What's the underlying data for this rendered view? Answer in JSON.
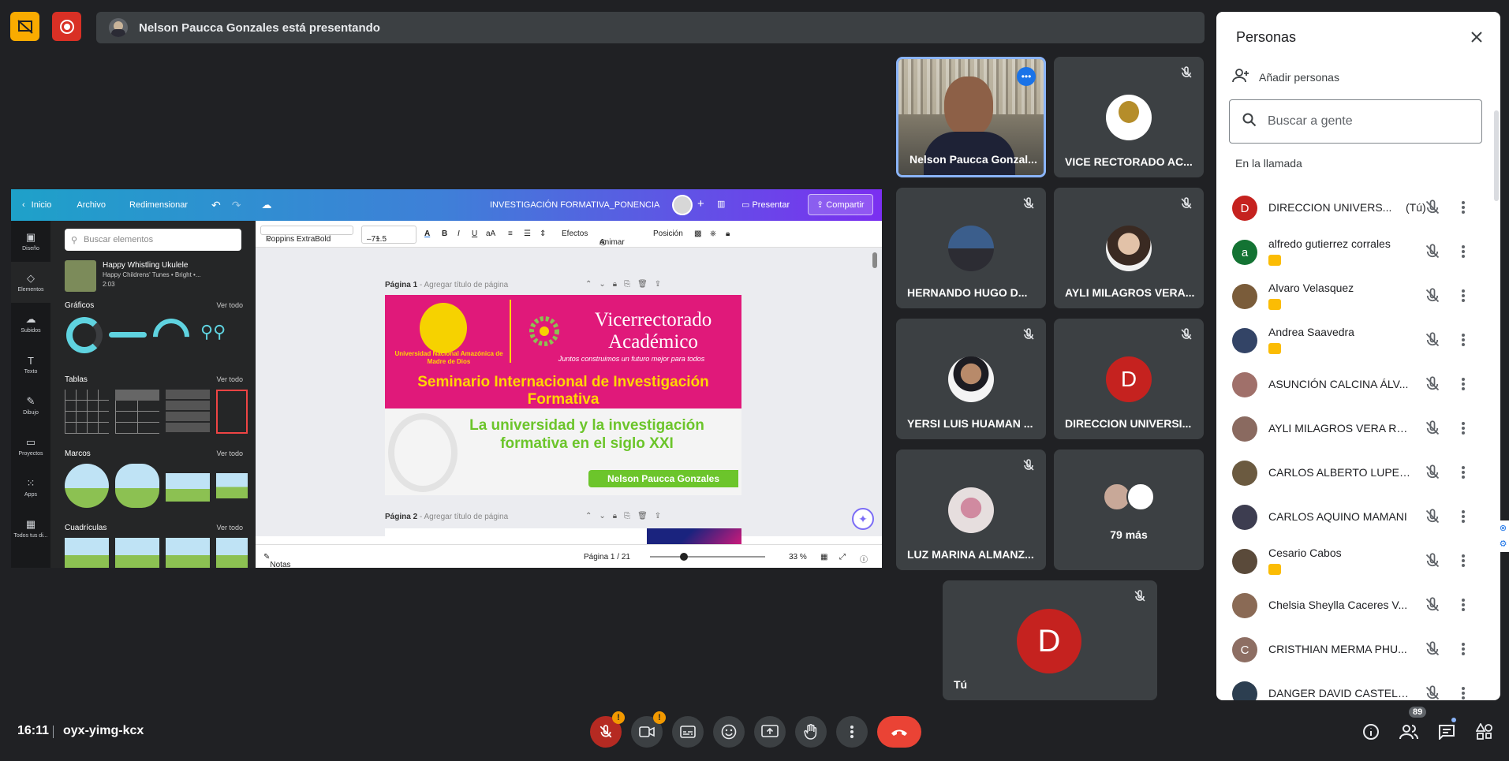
{
  "presenting_banner": "Nelson Paucca Gonzales está presentando",
  "canva": {
    "nav": {
      "home": "Inicio",
      "file": "Archivo",
      "resize": "Redimensionar"
    },
    "doc_title": "INVESTIGACIÓN FORMATIVA_PONENCIA",
    "present": "Presentar",
    "share": "Compartir",
    "rail": [
      "Diseño",
      "Elementos",
      "Subidos",
      "Texto",
      "Dibujo",
      "Proyectos",
      "Apps",
      "Todos tus di..."
    ],
    "search_placeholder": "Buscar elementos",
    "audio": {
      "title": "Happy Whistling Ukulele",
      "sub": "Happy Childrens' Tunes • Bright •...",
      "duration": "2:03"
    },
    "sections": {
      "graphics": "Gráficos",
      "tables": "Tablas",
      "frames": "Marcos",
      "grids": "Cuadrículas",
      "see_all": "Ver todo"
    },
    "toolbar": {
      "font": "Poppins ExtraBold",
      "size": "71.5",
      "minus": "–",
      "plus": "+",
      "effects": "Efectos",
      "animate": "Animar",
      "position": "Posición"
    },
    "page1": {
      "label": "Página 1",
      "hint": "- Agregar título de página"
    },
    "page2": {
      "label": "Página 2",
      "hint": "- Agregar título de página"
    },
    "slide": {
      "vice": "Vicerrectorado Académico",
      "university": "Universidad Nacional Amazónica de Madre de Dios",
      "motto": "Juntos construimos un futuro mejor para todos",
      "seminar": "Seminario Internacional de Investigación Formativa",
      "subtitle": "La universidad  y la investigación formativa en el siglo XXI",
      "presenter": "Nelson Paucca Gonzales"
    },
    "bottom": {
      "notes": "Notas",
      "page": "Página 1 / 21",
      "zoom": "33 %"
    }
  },
  "tiles": [
    {
      "name": "Nelson Paucca Gonzal...",
      "type": "video"
    },
    {
      "name": "VICE RECTORADO AC...",
      "type": "logo"
    },
    {
      "name": "HERNANDO HUGO D...",
      "type": "photo"
    },
    {
      "name": "AYLI MILAGROS VERA...",
      "type": "photo"
    },
    {
      "name": "YERSI LUIS HUAMAN ...",
      "type": "photo"
    },
    {
      "name": "DIRECCION UNIVERSI...",
      "type": "letter",
      "letter": "D"
    },
    {
      "name": "LUZ MARINA ALMANZ...",
      "type": "photo"
    },
    {
      "name": "79 más",
      "type": "more"
    },
    {
      "name": "Tú",
      "type": "letter",
      "letter": "D"
    }
  ],
  "people_panel": {
    "title": "Personas",
    "add_people": "Añadir personas",
    "search_placeholder": "Buscar a gente",
    "in_call": "En la llamada",
    "you_label": "(Tú)",
    "participants": [
      {
        "name": "DIRECCION UNIVERS...",
        "avatar": "D",
        "color": "#c5221f",
        "you": true,
        "host_badge": false
      },
      {
        "name": "alfredo gutierrez corrales",
        "avatar": "a",
        "color": "#137333",
        "you": false,
        "host_badge": true
      },
      {
        "name": "Alvaro Velasquez",
        "avatar": "",
        "color": "#7a5c3a",
        "you": false,
        "host_badge": true
      },
      {
        "name": "Andrea Saavedra",
        "avatar": "",
        "color": "#334466",
        "you": false,
        "host_badge": true
      },
      {
        "name": "ASUNCIÓN CALCINA ÁLV...",
        "avatar": "",
        "color": "#a0706a",
        "you": false,
        "host_badge": false
      },
      {
        "name": "AYLI MILAGROS VERA RO...",
        "avatar": "",
        "color": "#8a6a60",
        "you": false,
        "host_badge": false
      },
      {
        "name": "CARLOS ALBERTO LUPER...",
        "avatar": "",
        "color": "#6b5a40",
        "you": false,
        "host_badge": false
      },
      {
        "name": "CARLOS AQUINO MAMANI",
        "avatar": "",
        "color": "#3d3d50",
        "you": false,
        "host_badge": false
      },
      {
        "name": "Cesario Cabos",
        "avatar": "",
        "color": "#5a4a3a",
        "you": false,
        "host_badge": true
      },
      {
        "name": "Chelsia Sheylla Caceres V...",
        "avatar": "",
        "color": "#8a6a55",
        "you": false,
        "host_badge": false
      },
      {
        "name": "CRISTHIAN MERMA PHU...",
        "avatar": "C",
        "color": "#8d6e63",
        "you": false,
        "host_badge": false
      },
      {
        "name": "DANGER DAVID CASTELL...",
        "avatar": "",
        "color": "#2c3e50",
        "you": false,
        "host_badge": false
      }
    ]
  },
  "bottom_bar": {
    "time": "16:11",
    "meeting_code": "oyx-yimg-kcx",
    "people_count": "89",
    "warn_mark": "!"
  }
}
